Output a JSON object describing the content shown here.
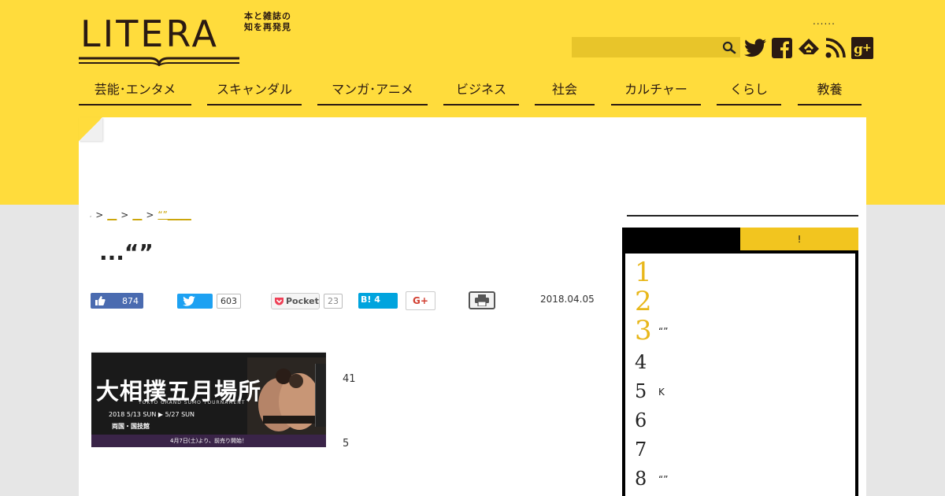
{
  "header": {
    "logo_text": "LITERA",
    "tagline_1": "本と雑誌の",
    "tagline_2": "知を再発見",
    "dots": "......",
    "search": {
      "value": "",
      "placeholder": ""
    }
  },
  "nav": {
    "items": [
      {
        "label": "芸能･エンタメ"
      },
      {
        "label": "スキャンダル"
      },
      {
        "label": "マンガ･アニメ"
      },
      {
        "label": "ビジネス"
      },
      {
        "label": "社会"
      },
      {
        "label": "カルチャー"
      },
      {
        "label": "くらし"
      },
      {
        "label": "教養"
      }
    ]
  },
  "breadcrumb": {
    "home": ",",
    "sep": ">",
    "items": [
      "__",
      "__",
      "“”_____"
    ]
  },
  "article": {
    "title": "...“”",
    "date": "2018.04.05",
    "side_text_1": "41",
    "side_text_2": "5",
    "image": {
      "title": "大相撲五月場所",
      "subtitle": "TOKYO GRAND SUMO TOURNAMENT",
      "dates": "2018  5/13 SUN ▶ 5/27 SUN",
      "venue": "両国・国技館",
      "notice": "4月7日(土)より、前売り開始！"
    }
  },
  "share": {
    "like_count": "874",
    "tweet_count": "603",
    "pocket_label": "Pocket",
    "pocket_count": "23",
    "hatena_label": "B! 4",
    "gplus_label": "G+"
  },
  "ranking": {
    "tab_b_label": "!",
    "items": [
      {
        "num": "1",
        "text": ""
      },
      {
        "num": "2",
        "text": ""
      },
      {
        "num": "3",
        "text": "“”"
      },
      {
        "num": "4",
        "text": ""
      },
      {
        "num": "5",
        "text": "K"
      },
      {
        "num": "6",
        "text": ""
      },
      {
        "num": "7",
        "text": ""
      },
      {
        "num": "8",
        "text": "“”"
      }
    ]
  },
  "colors": {
    "brand_yellow": "#ffdc3c",
    "accent_gold": "#e8b71a",
    "dark": "#2a1a12"
  },
  "icons": [
    "search-icon",
    "twitter-icon",
    "facebook-icon",
    "feedly-icon",
    "rss-icon",
    "google-plus-icon",
    "print-icon",
    "thumbs-up-icon",
    "pocket-icon"
  ]
}
